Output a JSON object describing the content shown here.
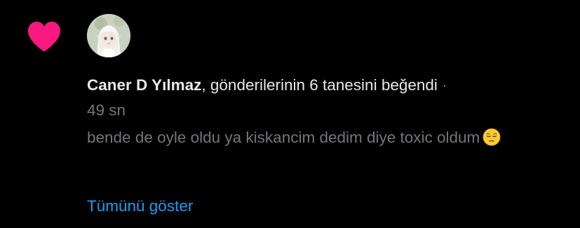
{
  "notification": {
    "user_name": "Caner D Yılmaz",
    "action_text": ", gönderilerinin 6 tanesini beğendi",
    "separator": "·",
    "timestamp": "49 sn",
    "post_text": "bende de oyle oldu ya kiskancim dedim diye toxic oldum",
    "emoji_icon": "pensive-face-icon",
    "show_all_label": "Tümünü göster",
    "heart_color": "#f91880",
    "link_color": "#1d9bf0",
    "heart_icon": "heart-icon",
    "avatar_icon": "anime-character-avatar"
  }
}
